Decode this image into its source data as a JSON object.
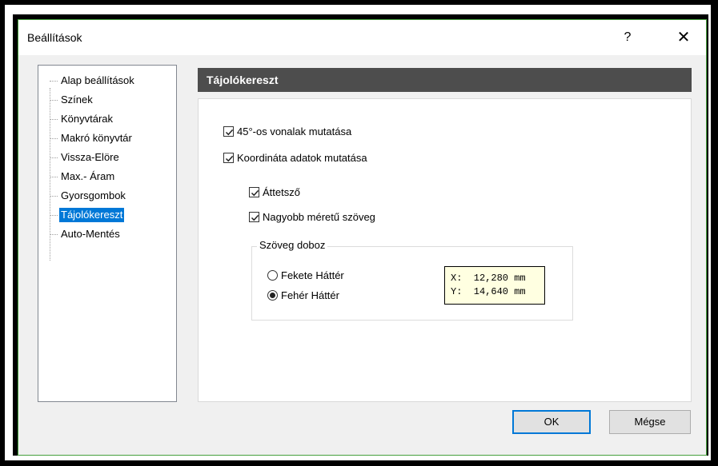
{
  "window": {
    "title": "Beállítások",
    "help_label": "?",
    "close_label": "✕"
  },
  "tree": {
    "items": [
      {
        "label": "Alap beállítások"
      },
      {
        "label": "Színek"
      },
      {
        "label": "Könyvtárak"
      },
      {
        "label": "Makró könyvtár"
      },
      {
        "label": "Vissza-Elöre"
      },
      {
        "label": "Max.- Áram"
      },
      {
        "label": "Gyorsgombok"
      },
      {
        "label": "Tájolókereszt",
        "selected": true
      },
      {
        "label": "Auto-Mentés"
      }
    ]
  },
  "panel": {
    "header": "Tájolókereszt",
    "options": [
      {
        "label": "45°-os vonalak mutatása",
        "checked": true
      },
      {
        "label": "Koordináta adatok mutatása",
        "checked": true
      },
      {
        "label": "Áttetsző",
        "checked": true
      },
      {
        "label": "Nagyobb méretű szöveg",
        "checked": true
      }
    ],
    "text_box": {
      "title": "Szöveg doboz",
      "radios": [
        {
          "label": "Fekete Háttér",
          "selected": false
        },
        {
          "label": "Fehér Háttér",
          "selected": true
        }
      ],
      "preview": {
        "x_line": "X:  12,280 mm",
        "y_line": "Y:  14,640 mm"
      }
    }
  },
  "buttons": {
    "ok_label": "OK",
    "cancel_label": "Mégse"
  },
  "colors": {
    "header_bg": "#4d4d4d",
    "selection": "#0078d7",
    "preview_bg": "#ffffe1",
    "dialog_border": "#46a03c"
  }
}
